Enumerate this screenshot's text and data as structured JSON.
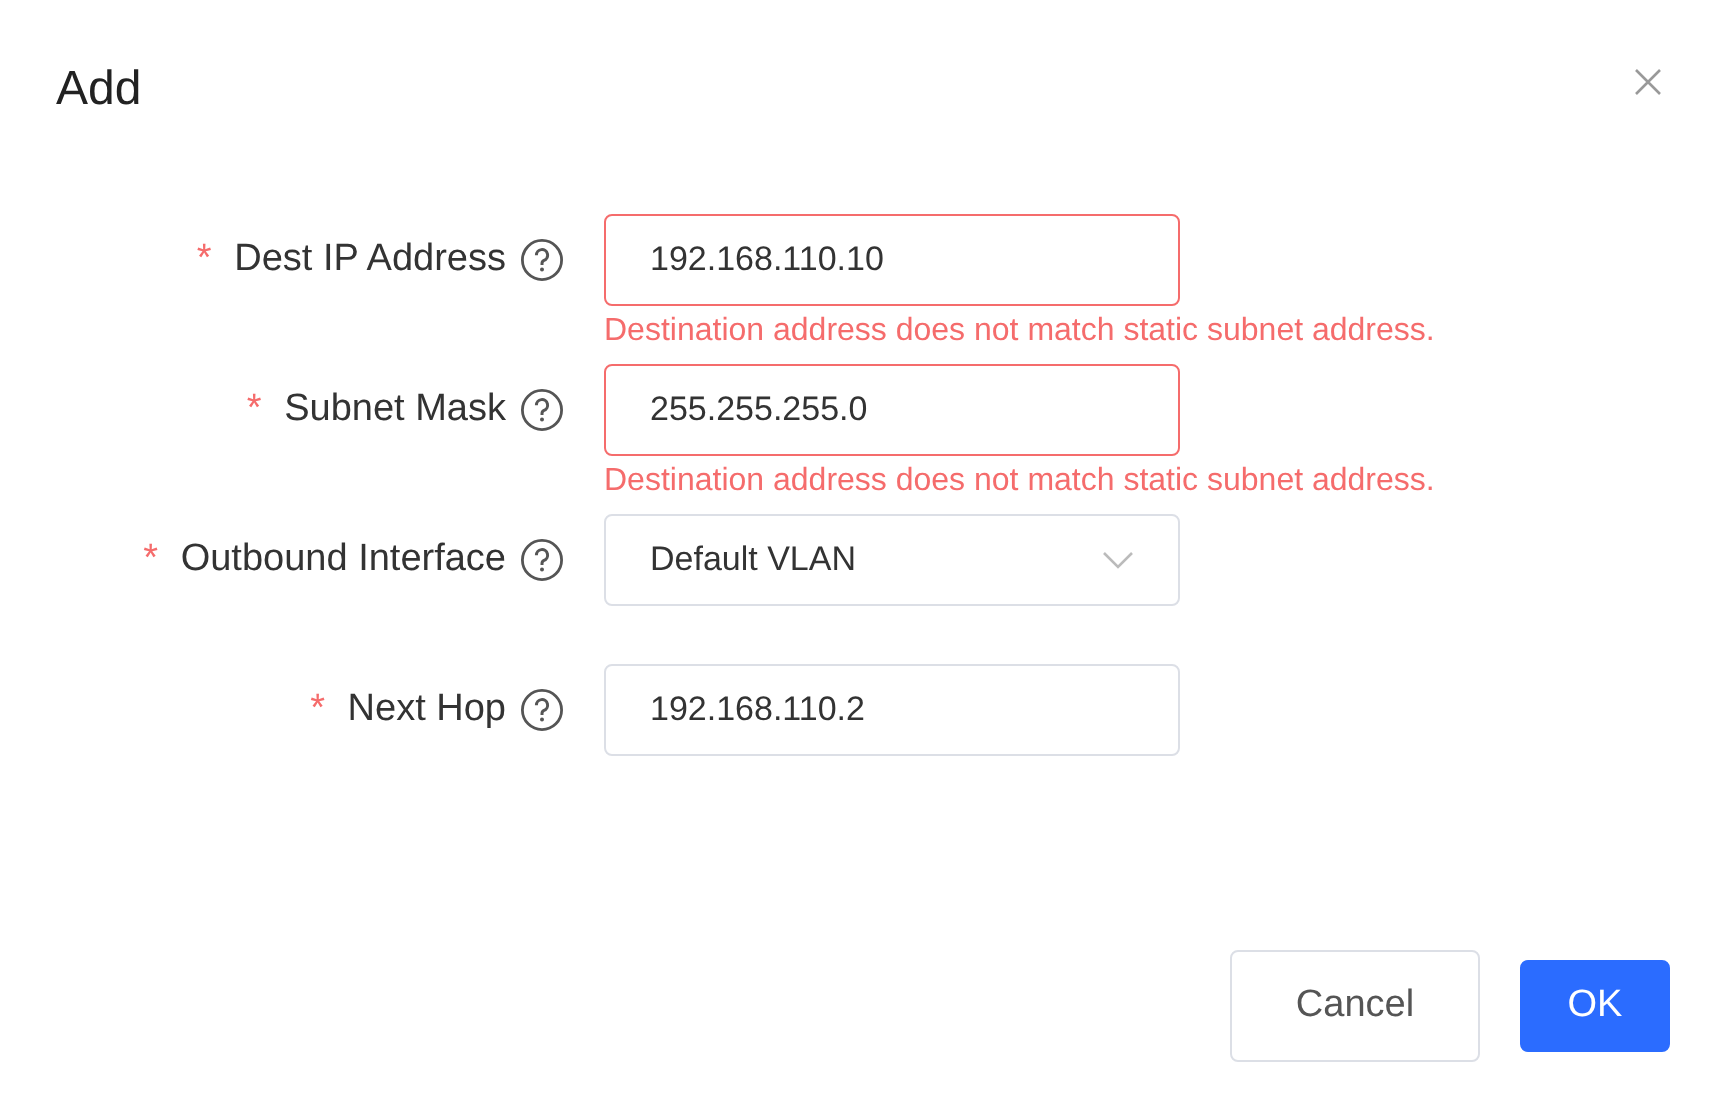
{
  "dialog": {
    "title": "Add"
  },
  "fields": [
    {
      "kind": "text",
      "mark": "*",
      "label": "Dest IP Address",
      "value": "192.168.110.10",
      "error": "Destination address does not match static subnet address."
    },
    {
      "kind": "text",
      "mark": "*",
      "label": "Subnet Mask",
      "value": "255.255.255.0",
      "error": "Destination address does not match static subnet address."
    },
    {
      "kind": "select",
      "mark": "*",
      "label": "Outbound Interface",
      "value": "Default VLAN"
    },
    {
      "kind": "text",
      "mark": "*",
      "label": "Next Hop",
      "value": "192.168.110.2"
    }
  ],
  "buttons": [
    {
      "label": "Cancel",
      "kind": "secondary"
    },
    {
      "label": "OK",
      "kind": "primary"
    }
  ]
}
